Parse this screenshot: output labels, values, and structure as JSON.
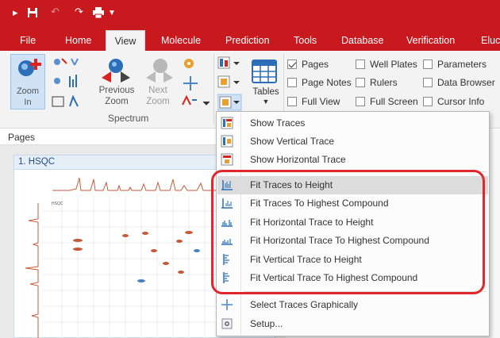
{
  "tabs": [
    "File",
    "Home",
    "View",
    "Molecule",
    "Prediction",
    "Tools",
    "Database",
    "Verification",
    "Eluc"
  ],
  "ribbon": {
    "zoom_in": [
      "Zoom",
      "In"
    ],
    "previous_zoom": [
      "Previous",
      "Zoom"
    ],
    "next_zoom": [
      "Next",
      "Zoom"
    ],
    "group_spectrum": "Spectrum",
    "tables": "Tables",
    "checks": [
      {
        "label": "Pages",
        "checked": true
      },
      {
        "label": "Well Plates",
        "checked": false
      },
      {
        "label": "Parameters",
        "checked": false
      },
      {
        "label": "Page Notes",
        "checked": false
      },
      {
        "label": "Rulers",
        "checked": false
      },
      {
        "label": "Data Browser",
        "checked": false
      },
      {
        "label": "Full View",
        "checked": false
      },
      {
        "label": "Full Screen",
        "checked": false
      },
      {
        "label": "Cursor Info",
        "checked": false
      }
    ]
  },
  "panel": {
    "pages_label": "Pages",
    "doc_title": "1. HSQC"
  },
  "menu": {
    "items": [
      {
        "label": "Show Traces",
        "icon": "show-traces-icon"
      },
      {
        "label": "Show Vertical Trace",
        "icon": "show-vertical-trace-icon"
      },
      {
        "label": "Show Horizontal Trace",
        "icon": "show-horizontal-trace-icon"
      },
      {
        "label": "Fit Traces to Height",
        "icon": "fit-traces-height-icon",
        "hover": true
      },
      {
        "label": "Fit Traces To Highest Compound",
        "icon": "fit-traces-highest-icon"
      },
      {
        "label": "Fit Horizontal Trace to Height",
        "icon": "fit-horizontal-height-icon"
      },
      {
        "label": "Fit Horizontal Trace To Highest Compound",
        "icon": "fit-horizontal-highest-icon"
      },
      {
        "label": "Fit Vertical Trace to Height",
        "icon": "fit-vertical-height-icon"
      },
      {
        "label": "Fit Vertical Trace To Highest Compound",
        "icon": "fit-vertical-highest-icon"
      },
      {
        "label": "Select Traces Graphically",
        "icon": "crosshair-icon"
      },
      {
        "label": "Setup...",
        "icon": "setup-icon"
      }
    ]
  },
  "colors": {
    "brand_red": "#c8191e",
    "highlight_ring": "#e2262e",
    "hover_bg": "#dcdcdc"
  }
}
